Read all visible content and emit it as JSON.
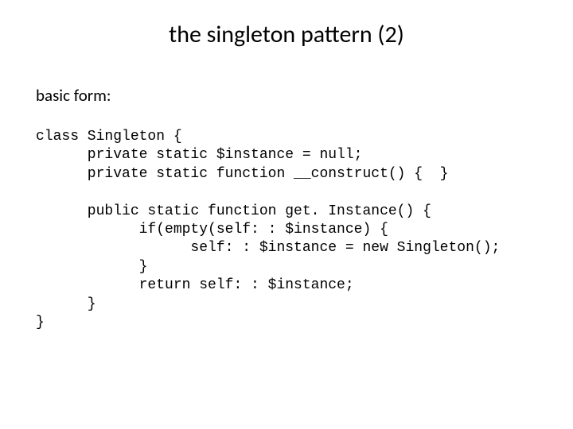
{
  "title": "the singleton pattern (2)",
  "subtitle": "basic form:",
  "code": {
    "line1": "class Singleton {",
    "line2": "      private static $instance = null;",
    "line3": "      private static function __construct() {  }",
    "line4": "",
    "line5": "      public static function get. Instance() {",
    "line6": "            if(empty(self: : $instance) {",
    "line7": "                  self: : $instance = new Singleton();",
    "line8": "            }",
    "line9": "            return self: : $instance;",
    "line10": "      }",
    "line11": "}"
  }
}
